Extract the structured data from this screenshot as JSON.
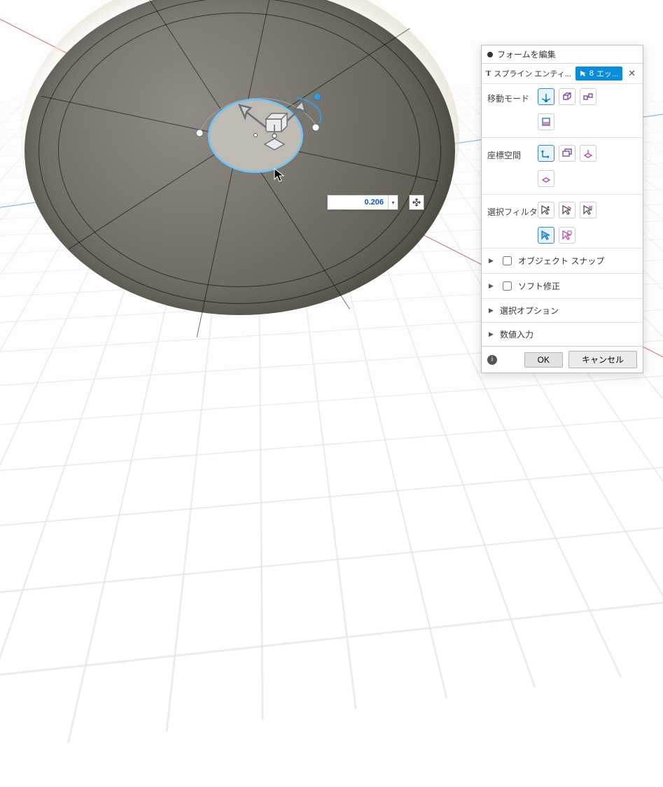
{
  "panel": {
    "title": "フォームを編集",
    "entity_row": {
      "t_label": "T",
      "name": "スプライン エンティ...",
      "chip_count": "8",
      "chip_text": "エッ..."
    },
    "rows": {
      "move_mode": {
        "label": "移動モード"
      },
      "coord_space": {
        "label": "座標空間"
      },
      "sel_filter": {
        "label": "選択フィルタ"
      }
    },
    "collapses": {
      "object_snap": {
        "label": "オブジェクト スナップ",
        "checked": false
      },
      "soft_mod": {
        "label": "ソフト修正",
        "checked": false
      },
      "sel_options": {
        "label": "選択オプション"
      },
      "num_input": {
        "label": "数値入力"
      }
    },
    "footer": {
      "ok": "OK",
      "cancel": "キャンセル"
    }
  },
  "manipulator": {
    "value": "0.206"
  }
}
